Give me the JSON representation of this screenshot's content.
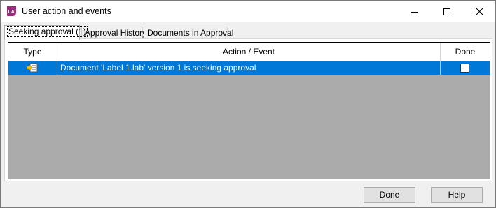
{
  "window": {
    "title": "User action and events",
    "app_icon_text": "LA",
    "controls": {
      "minimize_icon": "minimize-icon",
      "maximize_icon": "maximize-icon",
      "close_icon": "close-icon"
    }
  },
  "tabs": [
    {
      "label": "Seeking approval (1)",
      "active": true
    },
    {
      "label": "Approval History",
      "active": false
    },
    {
      "label": "Documents in Approval",
      "active": false
    }
  ],
  "grid": {
    "columns": [
      "Type",
      "Action / Event",
      "Done"
    ],
    "rows": [
      {
        "type_icon": "document-approval-icon",
        "action": "Document 'Label 1.lab' version 1 is seeking approval",
        "done": false,
        "selected": true
      }
    ]
  },
  "buttons": {
    "done": "Done",
    "help": "Help"
  },
  "colors": {
    "selection": "#0078d7",
    "grid_background": "#ababab",
    "app_icon": "#9c2a7d"
  }
}
